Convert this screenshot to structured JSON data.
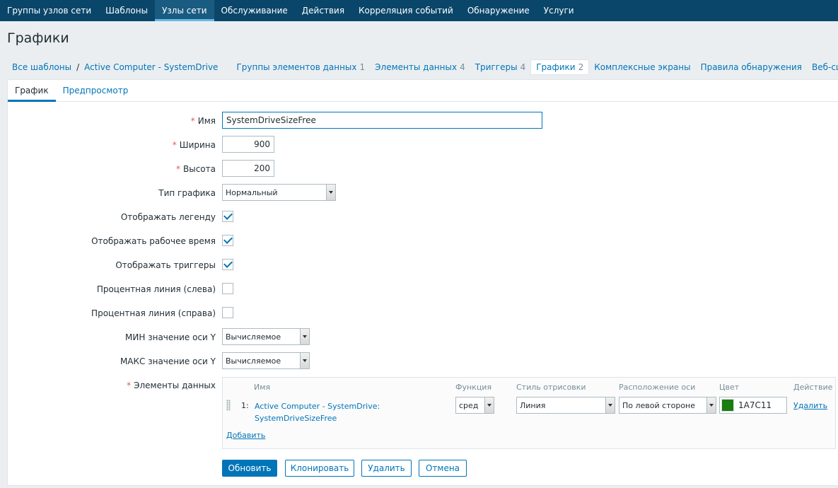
{
  "nav": {
    "items": [
      "Группы узлов сети",
      "Шаблоны",
      "Узлы сети",
      "Обслуживание",
      "Действия",
      "Корреляция событий",
      "Обнаружение",
      "Услуги"
    ],
    "active_index": 2
  },
  "page_title": "Графики",
  "breadcrumbs": {
    "all_templates": "Все шаблоны",
    "separator": "/",
    "template": "Active Computer - SystemDrive",
    "links": [
      {
        "label": "Группы элементов данных",
        "count": "1"
      },
      {
        "label": "Элементы данных",
        "count": "4"
      },
      {
        "label": "Триггеры",
        "count": "4"
      },
      {
        "label": "Графики",
        "count": "2"
      },
      {
        "label": "Комплексные экраны",
        "count": ""
      },
      {
        "label": "Правила обнаружения",
        "count": ""
      },
      {
        "label": "Веб-сценарии",
        "count": ""
      }
    ]
  },
  "tabs": [
    "График",
    "Предпросмотр"
  ],
  "form": {
    "required_mark": "*",
    "name": {
      "label": "Имя",
      "value": "SystemDriveSizeFree"
    },
    "width": {
      "label": "Ширина",
      "value": "900"
    },
    "height": {
      "label": "Высота",
      "value": "200"
    },
    "graph_type": {
      "label": "Тип графика",
      "value": "Нормальный"
    },
    "show_legend": {
      "label": "Отображать легенду",
      "checked": true
    },
    "show_work_period": {
      "label": "Отображать рабочее время",
      "checked": true
    },
    "show_triggers": {
      "label": "Отображать триггеры",
      "checked": true
    },
    "percent_left": {
      "label": "Процентная линия (слева)",
      "checked": false
    },
    "percent_right": {
      "label": "Процентная линия (справа)",
      "checked": false
    },
    "ymin": {
      "label": "МИН значение оси Y",
      "value": "Вычисляемое"
    },
    "ymax": {
      "label": "МАКС значение оси Y",
      "value": "Вычисляемое"
    },
    "items_label": "Элементы данных"
  },
  "items_table": {
    "headers": [
      "Имя",
      "Функция",
      "Стиль отрисовки",
      "Расположение оси",
      "Цвет",
      "Действие"
    ],
    "rows": [
      {
        "num": "1:",
        "name_line1": "Active Computer - SystemDrive:",
        "name_line2": "SystemDriveSizeFree",
        "function": "сред",
        "draw_style": "Линия",
        "axis_side": "По левой стороне",
        "color": "1A7C11",
        "action": "Удалить"
      }
    ],
    "add_label": "Добавить"
  },
  "buttons": {
    "update": "Обновить",
    "clone": "Клонировать",
    "delete": "Удалить",
    "cancel": "Отмена"
  },
  "colors": {
    "nav": "#0a466a",
    "link": "#0275b8",
    "swatch": "#1a7c11"
  }
}
